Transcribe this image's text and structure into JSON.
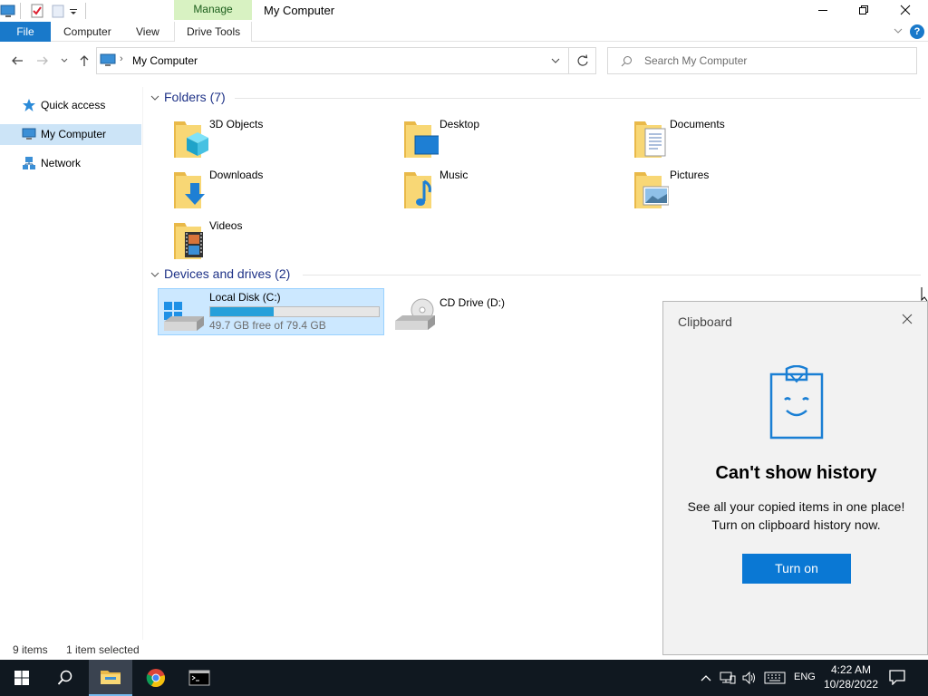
{
  "window": {
    "title": "My Computer",
    "contextual_tab": "Manage"
  },
  "ribbon": {
    "file": "File",
    "tabs": [
      "Computer",
      "View",
      "Drive Tools"
    ]
  },
  "address": {
    "path": "My Computer",
    "search_placeholder": "Search My Computer"
  },
  "sidebar": {
    "items": [
      {
        "label": "Quick access",
        "icon": "star-icon"
      },
      {
        "label": "My Computer",
        "icon": "computer-icon",
        "selected": true
      },
      {
        "label": "Network",
        "icon": "network-icon"
      }
    ]
  },
  "groups": {
    "folders": "Folders (7)",
    "drives": "Devices and drives (2)"
  },
  "folders": [
    {
      "name": "3D Objects",
      "icon": "3d-objects-folder-icon"
    },
    {
      "name": "Desktop",
      "icon": "desktop-folder-icon"
    },
    {
      "name": "Documents",
      "icon": "documents-folder-icon"
    },
    {
      "name": "Downloads",
      "icon": "downloads-folder-icon"
    },
    {
      "name": "Music",
      "icon": "music-folder-icon"
    },
    {
      "name": "Pictures",
      "icon": "pictures-folder-icon"
    },
    {
      "name": "Videos",
      "icon": "videos-folder-icon"
    }
  ],
  "drives": [
    {
      "name": "Local Disk (C:)",
      "free_text": "49.7 GB free of 79.4 GB",
      "used_fraction": 0.374,
      "bar_color": "#26a0da"
    },
    {
      "name": "CD Drive (D:)"
    }
  ],
  "status": {
    "items": "9 items",
    "selected": "1 item selected"
  },
  "clipboard": {
    "title": "Clipboard",
    "heading": "Can't show history",
    "line1": "See all your copied items in one place!",
    "line2": "Turn on clipboard history now.",
    "button": "Turn on",
    "accent": "#0a78d4"
  },
  "taskbar": {
    "language": "ENG",
    "time": "4:22 AM",
    "date": "10/28/2022"
  }
}
